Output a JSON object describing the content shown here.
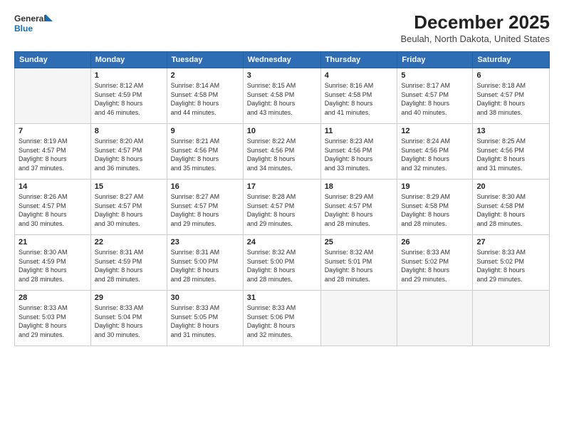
{
  "header": {
    "logo_line1": "General",
    "logo_line2": "Blue",
    "month": "December 2025",
    "location": "Beulah, North Dakota, United States"
  },
  "weekdays": [
    "Sunday",
    "Monday",
    "Tuesday",
    "Wednesday",
    "Thursday",
    "Friday",
    "Saturday"
  ],
  "weeks": [
    [
      {
        "num": "",
        "info": ""
      },
      {
        "num": "1",
        "info": "Sunrise: 8:12 AM\nSunset: 4:59 PM\nDaylight: 8 hours\nand 46 minutes."
      },
      {
        "num": "2",
        "info": "Sunrise: 8:14 AM\nSunset: 4:58 PM\nDaylight: 8 hours\nand 44 minutes."
      },
      {
        "num": "3",
        "info": "Sunrise: 8:15 AM\nSunset: 4:58 PM\nDaylight: 8 hours\nand 43 minutes."
      },
      {
        "num": "4",
        "info": "Sunrise: 8:16 AM\nSunset: 4:58 PM\nDaylight: 8 hours\nand 41 minutes."
      },
      {
        "num": "5",
        "info": "Sunrise: 8:17 AM\nSunset: 4:57 PM\nDaylight: 8 hours\nand 40 minutes."
      },
      {
        "num": "6",
        "info": "Sunrise: 8:18 AM\nSunset: 4:57 PM\nDaylight: 8 hours\nand 38 minutes."
      }
    ],
    [
      {
        "num": "7",
        "info": "Sunrise: 8:19 AM\nSunset: 4:57 PM\nDaylight: 8 hours\nand 37 minutes."
      },
      {
        "num": "8",
        "info": "Sunrise: 8:20 AM\nSunset: 4:57 PM\nDaylight: 8 hours\nand 36 minutes."
      },
      {
        "num": "9",
        "info": "Sunrise: 8:21 AM\nSunset: 4:56 PM\nDaylight: 8 hours\nand 35 minutes."
      },
      {
        "num": "10",
        "info": "Sunrise: 8:22 AM\nSunset: 4:56 PM\nDaylight: 8 hours\nand 34 minutes."
      },
      {
        "num": "11",
        "info": "Sunrise: 8:23 AM\nSunset: 4:56 PM\nDaylight: 8 hours\nand 33 minutes."
      },
      {
        "num": "12",
        "info": "Sunrise: 8:24 AM\nSunset: 4:56 PM\nDaylight: 8 hours\nand 32 minutes."
      },
      {
        "num": "13",
        "info": "Sunrise: 8:25 AM\nSunset: 4:56 PM\nDaylight: 8 hours\nand 31 minutes."
      }
    ],
    [
      {
        "num": "14",
        "info": "Sunrise: 8:26 AM\nSunset: 4:57 PM\nDaylight: 8 hours\nand 30 minutes."
      },
      {
        "num": "15",
        "info": "Sunrise: 8:27 AM\nSunset: 4:57 PM\nDaylight: 8 hours\nand 30 minutes."
      },
      {
        "num": "16",
        "info": "Sunrise: 8:27 AM\nSunset: 4:57 PM\nDaylight: 8 hours\nand 29 minutes."
      },
      {
        "num": "17",
        "info": "Sunrise: 8:28 AM\nSunset: 4:57 PM\nDaylight: 8 hours\nand 29 minutes."
      },
      {
        "num": "18",
        "info": "Sunrise: 8:29 AM\nSunset: 4:57 PM\nDaylight: 8 hours\nand 28 minutes."
      },
      {
        "num": "19",
        "info": "Sunrise: 8:29 AM\nSunset: 4:58 PM\nDaylight: 8 hours\nand 28 minutes."
      },
      {
        "num": "20",
        "info": "Sunrise: 8:30 AM\nSunset: 4:58 PM\nDaylight: 8 hours\nand 28 minutes."
      }
    ],
    [
      {
        "num": "21",
        "info": "Sunrise: 8:30 AM\nSunset: 4:59 PM\nDaylight: 8 hours\nand 28 minutes."
      },
      {
        "num": "22",
        "info": "Sunrise: 8:31 AM\nSunset: 4:59 PM\nDaylight: 8 hours\nand 28 minutes."
      },
      {
        "num": "23",
        "info": "Sunrise: 8:31 AM\nSunset: 5:00 PM\nDaylight: 8 hours\nand 28 minutes."
      },
      {
        "num": "24",
        "info": "Sunrise: 8:32 AM\nSunset: 5:00 PM\nDaylight: 8 hours\nand 28 minutes."
      },
      {
        "num": "25",
        "info": "Sunrise: 8:32 AM\nSunset: 5:01 PM\nDaylight: 8 hours\nand 28 minutes."
      },
      {
        "num": "26",
        "info": "Sunrise: 8:33 AM\nSunset: 5:02 PM\nDaylight: 8 hours\nand 29 minutes."
      },
      {
        "num": "27",
        "info": "Sunrise: 8:33 AM\nSunset: 5:02 PM\nDaylight: 8 hours\nand 29 minutes."
      }
    ],
    [
      {
        "num": "28",
        "info": "Sunrise: 8:33 AM\nSunset: 5:03 PM\nDaylight: 8 hours\nand 29 minutes."
      },
      {
        "num": "29",
        "info": "Sunrise: 8:33 AM\nSunset: 5:04 PM\nDaylight: 8 hours\nand 30 minutes."
      },
      {
        "num": "30",
        "info": "Sunrise: 8:33 AM\nSunset: 5:05 PM\nDaylight: 8 hours\nand 31 minutes."
      },
      {
        "num": "31",
        "info": "Sunrise: 8:33 AM\nSunset: 5:06 PM\nDaylight: 8 hours\nand 32 minutes."
      },
      {
        "num": "",
        "info": ""
      },
      {
        "num": "",
        "info": ""
      },
      {
        "num": "",
        "info": ""
      }
    ]
  ]
}
